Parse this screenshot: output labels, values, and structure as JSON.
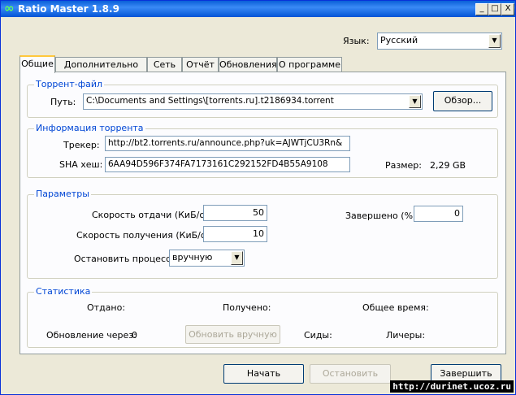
{
  "window": {
    "title": "Ratio Master 1.8.9",
    "buttons": {
      "minimize": "_",
      "maximize": "□",
      "close": "X"
    }
  },
  "language": {
    "label": "Язык:",
    "value": "Русский"
  },
  "tabs": [
    {
      "label": "Общие",
      "active": true
    },
    {
      "label": "Дополнительно",
      "active": false
    },
    {
      "label": "Сеть",
      "active": false
    },
    {
      "label": "Отчёт",
      "active": false
    },
    {
      "label": "Обновления",
      "active": false
    },
    {
      "label": "О программе",
      "active": false
    }
  ],
  "torrent_file": {
    "legend": "Торрент-файл",
    "path_label": "Путь:",
    "path_value": "C:\\Documents and Settings\\[torrents.ru].t2186934.torrent",
    "browse_label": "Обзор..."
  },
  "torrent_info": {
    "legend": "Информация торрента",
    "tracker_label": "Трекер:",
    "tracker_value": "http://bt2.torrents.ru/announce.php?uk=AJWTjCU3Rn&",
    "sha_label": "SHA хеш:",
    "sha_value": "6AA94D596F374FA7173161C292152FD4B55A9108",
    "size_label": "Размер:",
    "size_value": "2,29 GB"
  },
  "params": {
    "legend": "Параметры",
    "upload_label": "Скорость отдачи (КиБ/с):",
    "upload_value": "50",
    "download_label": "Скорость получения (КиБ/с):",
    "download_value": "10",
    "stop_label": "Остановить процесс",
    "stop_value": "вручную",
    "completed_label": "Завершено (%)",
    "completed_value": "0"
  },
  "stats": {
    "legend": "Статистика",
    "uploaded_label": "Отдано:",
    "downloaded_label": "Получено:",
    "total_time_label": "Общее время:",
    "update_label": "Обновление через:",
    "update_value": "0",
    "update_button": "Обновить вручную",
    "seeders_label": "Сиды:",
    "leechers_label": "Личеры:"
  },
  "actions": {
    "start": "Начать",
    "stop": "Остановить",
    "finish": "Завершить"
  },
  "watermark": "http://durinet.ucoz.ru"
}
